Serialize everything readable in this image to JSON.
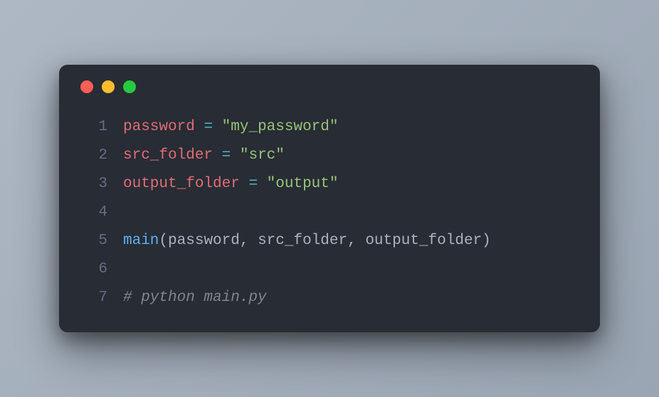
{
  "window": {
    "traffic_lights": {
      "close_color": "#ff5f56",
      "minimize_color": "#ffbd2e",
      "maximize_color": "#27c93f"
    }
  },
  "code": {
    "lines": [
      {
        "number": "1",
        "tokens": [
          {
            "text": "password",
            "type": "var"
          },
          {
            "text": " ",
            "type": "default"
          },
          {
            "text": "=",
            "type": "op"
          },
          {
            "text": " ",
            "type": "default"
          },
          {
            "text": "\"my_password\"",
            "type": "str"
          }
        ]
      },
      {
        "number": "2",
        "tokens": [
          {
            "text": "src_folder",
            "type": "var"
          },
          {
            "text": " ",
            "type": "default"
          },
          {
            "text": "=",
            "type": "op"
          },
          {
            "text": " ",
            "type": "default"
          },
          {
            "text": "\"src\"",
            "type": "str"
          }
        ]
      },
      {
        "number": "3",
        "tokens": [
          {
            "text": "output_folder",
            "type": "var"
          },
          {
            "text": " ",
            "type": "default"
          },
          {
            "text": "=",
            "type": "op"
          },
          {
            "text": " ",
            "type": "default"
          },
          {
            "text": "\"output\"",
            "type": "str"
          }
        ]
      },
      {
        "number": "4",
        "tokens": []
      },
      {
        "number": "5",
        "tokens": [
          {
            "text": "main",
            "type": "func"
          },
          {
            "text": "(",
            "type": "punc"
          },
          {
            "text": "password",
            "type": "arg"
          },
          {
            "text": ",",
            "type": "punc"
          },
          {
            "text": " ",
            "type": "default"
          },
          {
            "text": "src_folder",
            "type": "arg"
          },
          {
            "text": ",",
            "type": "punc"
          },
          {
            "text": " ",
            "type": "default"
          },
          {
            "text": "output_folder",
            "type": "arg"
          },
          {
            "text": ")",
            "type": "punc"
          }
        ]
      },
      {
        "number": "6",
        "tokens": []
      },
      {
        "number": "7",
        "tokens": [
          {
            "text": "# python main.py",
            "type": "comment"
          }
        ]
      }
    ]
  }
}
